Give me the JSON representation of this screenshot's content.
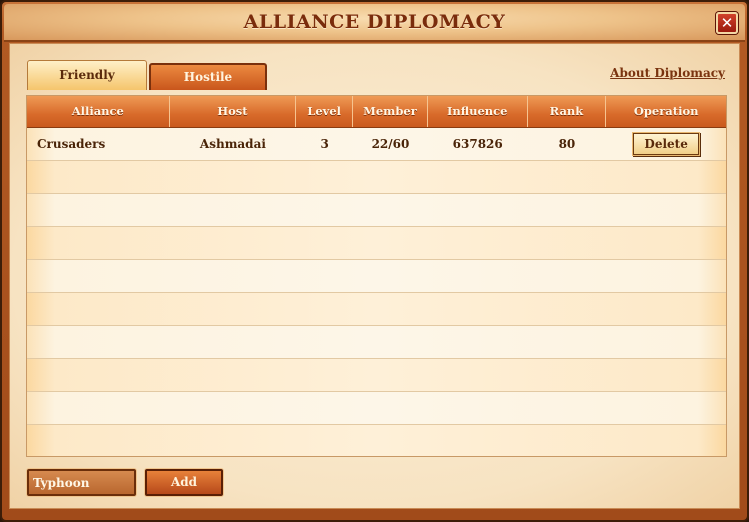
{
  "window": {
    "title": "ALLIANCE DIPLOMACY",
    "close_label": "✕"
  },
  "tabs": [
    {
      "label": "Friendly",
      "active": true
    },
    {
      "label": "Hostile",
      "active": false
    }
  ],
  "about_link": "About Diplomacy",
  "table": {
    "columns": [
      "Alliance",
      "Host",
      "Level",
      "Member",
      "Influence",
      "Rank",
      "Operation"
    ],
    "rows": [
      {
        "alliance": "Crusaders",
        "host": "Ashmadai",
        "level": "3",
        "member": "22/60",
        "influence": "637826",
        "rank": "80",
        "operation": "Delete"
      }
    ]
  },
  "footer": {
    "input_value": "Typhoon",
    "add_label": "Add"
  },
  "colors": {
    "accent": "#d86a2a",
    "title_text": "#7a2c0c",
    "close_button": "#c0321f"
  }
}
